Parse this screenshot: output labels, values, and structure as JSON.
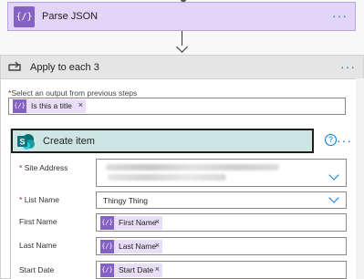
{
  "parse_json": {
    "title": "Parse JSON",
    "icon": "curly-braces-icon",
    "icon_text": "{/}",
    "menu": "···"
  },
  "apply_each": {
    "title": "Apply to each 3",
    "menu": "···",
    "select_label": "Select an output from previous steps",
    "required_mark": "*",
    "token": {
      "label": "Is this a title",
      "remove": "×"
    }
  },
  "create_item": {
    "title": "Create item",
    "help": "?",
    "menu": "···",
    "fields": {
      "site_address": {
        "label": "Site Address",
        "required_mark": "*"
      },
      "list_name": {
        "label": "List Name",
        "required_mark": "*",
        "value": "Thingy Thing"
      },
      "first_name": {
        "label": "First Name",
        "token": "First Name",
        "remove": "×"
      },
      "last_name": {
        "label": "Last Name",
        "token": "Last Name",
        "remove": "×"
      },
      "start_date": {
        "label": "Start Date",
        "token": "Start Date",
        "remove": "×"
      }
    }
  },
  "token_icon_text": "{/}",
  "colors": {
    "accent": "#0078d4",
    "token_icon": "#8661c5",
    "token_bg": "#e8def8",
    "parse_bg": "#e2d5f7",
    "sharepoint": "#036c70",
    "required": "#a4262c"
  }
}
